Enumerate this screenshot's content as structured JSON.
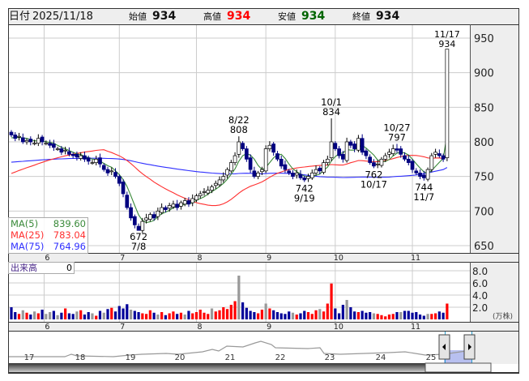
{
  "header": {
    "date_label": "日付",
    "date": "2025/11/18",
    "open_label": "始値",
    "open": "934",
    "high_label": "高値",
    "high": "934",
    "low_label": "安値",
    "low": "934",
    "close_label": "終値",
    "close": "934"
  },
  "legend": [
    {
      "name": "MA(5)",
      "value": "839.60",
      "color": "#3a8a3a"
    },
    {
      "name": "MA(25)",
      "value": "783.04",
      "color": "#ff3030"
    },
    {
      "name": "MA(75)",
      "value": "764.96",
      "color": "#3030ff"
    }
  ],
  "volume": {
    "label": "出来高",
    "value": "0",
    "unit": "(万株)"
  },
  "colors": {
    "up_body": "#ffffff",
    "down_body": "#000080",
    "vol_up": "#ff0000",
    "vol_down": "#000099",
    "vol_flat": "#999999"
  },
  "chart_data": {
    "type": "candlestick",
    "price_axis": {
      "ticks": [
        "950",
        "900",
        "850",
        "800",
        "750",
        "700",
        "650"
      ],
      "range": [
        650,
        950
      ]
    },
    "volume_axis": {
      "ticks": [
        "8.0",
        "6.0",
        "4.0",
        "2.0"
      ],
      "range": [
        0,
        8
      ]
    },
    "month_ticks": [
      {
        "label": "6",
        "index": 8.5
      },
      {
        "label": "7",
        "index": 28
      },
      {
        "label": "8",
        "index": 48
      },
      {
        "label": "9",
        "index": 66
      },
      {
        "label": "10",
        "index": 84
      },
      {
        "label": "11",
        "index": 104
      }
    ],
    "close": [
      810,
      805,
      808,
      800,
      802,
      800,
      798,
      805,
      800,
      798,
      795,
      792,
      790,
      785,
      788,
      782,
      780,
      778,
      780,
      775,
      772,
      770,
      775,
      768,
      760,
      755,
      758,
      750,
      740,
      725,
      705,
      690,
      680,
      672,
      685,
      690,
      695,
      690,
      700,
      705,
      702,
      708,
      710,
      705,
      712,
      715,
      710,
      718,
      722,
      725,
      728,
      730,
      735,
      740,
      745,
      750,
      760,
      770,
      780,
      800,
      790,
      775,
      760,
      750,
      755,
      760,
      790,
      795,
      785,
      775,
      765,
      760,
      755,
      750,
      755,
      748,
      745,
      750,
      755,
      760,
      758,
      770,
      775,
      800,
      790,
      780,
      775,
      800,
      795,
      790,
      805,
      785,
      780,
      770,
      765,
      768,
      775,
      780,
      785,
      790,
      788,
      782,
      775,
      770,
      760,
      755,
      750,
      748,
      760,
      780,
      785,
      780,
      775,
      934
    ],
    "volume": [
      2.0,
      1.2,
      0.9,
      1.5,
      1.1,
      0.8,
      1.3,
      1.0,
      1.6,
      0.9,
      1.2,
      1.4,
      0.7,
      1.1,
      1.8,
      1.0,
      0.9,
      1.3,
      1.5,
      0.8,
      1.2,
      1.0,
      0.6,
      1.4,
      1.1,
      1.7,
      1.9,
      1.3,
      2.2,
      1.8,
      2.5,
      1.6,
      1.4,
      1.2,
      1.0,
      0.9,
      1.5,
      1.1,
      0.8,
      1.2,
      0.7,
      1.0,
      1.3,
      0.9,
      1.1,
      0.8,
      1.4,
      1.0,
      1.2,
      1.6,
      1.1,
      0.9,
      1.8,
      1.3,
      1.5,
      2.0,
      1.7,
      2.4,
      3.0,
      7.2,
      2.8,
      1.9,
      1.4,
      1.2,
      1.0,
      1.6,
      2.6,
      1.8,
      1.5,
      1.2,
      1.0,
      0.9,
      1.3,
      1.1,
      0.8,
      1.0,
      1.4,
      1.2,
      0.9,
      1.5,
      1.7,
      1.3,
      2.6,
      5.9,
      1.8,
      1.0,
      2.4,
      3.2,
      2.0,
      1.3,
      1.2,
      1.4,
      1.1,
      1.2,
      1.0,
      0.9,
      0.7,
      0.5,
      0.8,
      0.9,
      1.2,
      1.2,
      1.4,
      1.4,
      1.1,
      1.2,
      0.8,
      0.6,
      0.9,
      0.9,
      1.0,
      1.3,
      1.1,
      2.6
    ],
    "annotations": [
      {
        "index": 33,
        "date": "7/8",
        "price": "672",
        "kind": "low"
      },
      {
        "index": 59,
        "date": "8/22",
        "price": "808",
        "kind": "high"
      },
      {
        "index": 76,
        "date": "9/19",
        "price": "742",
        "kind": "low"
      },
      {
        "index": 83,
        "date": "10/1",
        "price": "834",
        "kind": "high"
      },
      {
        "index": 94,
        "date": "10/17",
        "price": "762",
        "kind": "low"
      },
      {
        "index": 100,
        "date": "10/27",
        "price": "797",
        "kind": "high"
      },
      {
        "index": 107,
        "date": "11/7",
        "price": "744",
        "kind": "low"
      },
      {
        "index": 113,
        "date": "11/17",
        "price": "934",
        "kind": "high"
      }
    ]
  },
  "navigator": {
    "year_labels": [
      "17",
      "18",
      "19",
      "20",
      "21",
      "22",
      "23",
      "24",
      "25"
    ]
  }
}
